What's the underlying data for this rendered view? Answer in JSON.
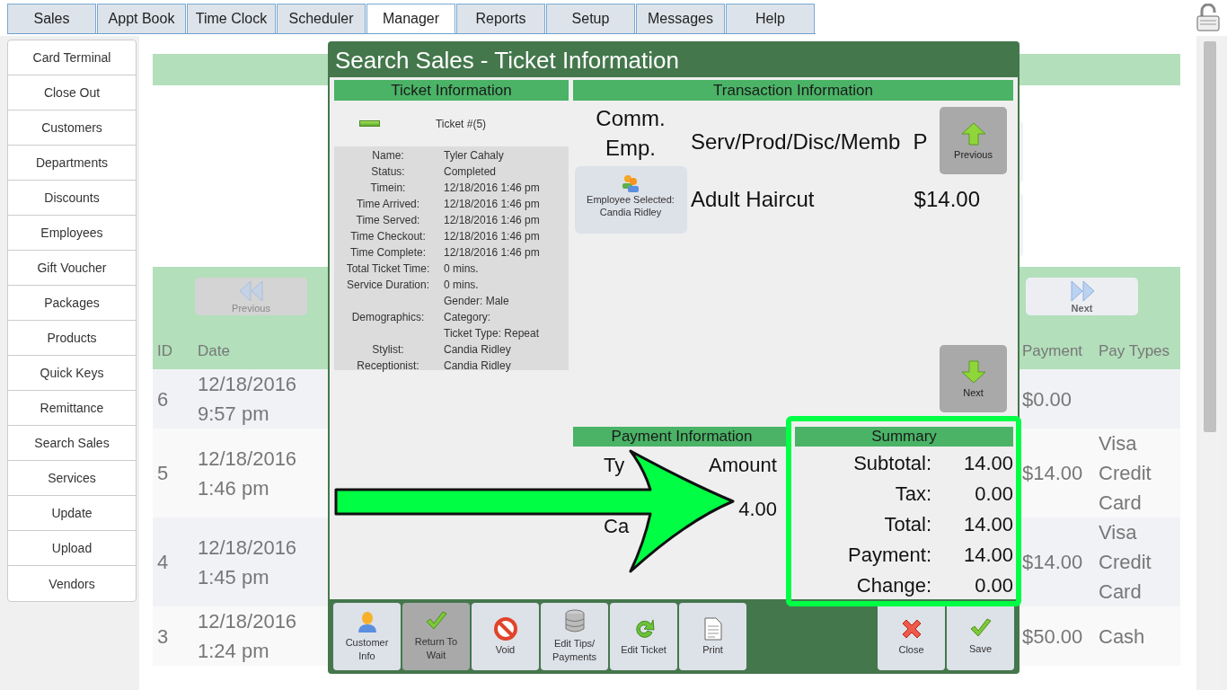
{
  "tabs": [
    {
      "label": "Sales",
      "selected": false
    },
    {
      "label": "Appt Book",
      "selected": false
    },
    {
      "label": "Time Clock",
      "selected": false
    },
    {
      "label": "Scheduler",
      "selected": false
    },
    {
      "label": "Manager",
      "selected": true
    },
    {
      "label": "Reports",
      "selected": false
    },
    {
      "label": "Setup",
      "selected": false
    },
    {
      "label": "Messages",
      "selected": false
    },
    {
      "label": "Help",
      "selected": false
    }
  ],
  "sidebar": {
    "items": [
      "Card Terminal",
      "Close Out",
      "Customers",
      "Departments",
      "Discounts",
      "Employees",
      "Gift Voucher",
      "Packages",
      "Products",
      "Quick Keys",
      "Remittance",
      "Search Sales",
      "Services",
      "Update",
      "Upload",
      "Vendors"
    ]
  },
  "page": {
    "nav_buttons": [
      {
        "label": "Previous",
        "kind": "previous",
        "disabled": true
      },
      {
        "label": "Next",
        "kind": "next",
        "disabled": false
      }
    ],
    "table": {
      "columns": [
        "ID",
        "Date",
        "Payment",
        "Pay Types"
      ],
      "rows": [
        {
          "id": "6",
          "date": "12/18/2016 9:57 pm",
          "payment": "$0.00"
        },
        {
          "id": "5",
          "date": "12/18/2016 1:46 pm",
          "payment": "$14.00",
          "pay_types": "Visa Credit Card"
        },
        {
          "id": "4",
          "date": "12/18/2016 1:45 pm",
          "payment": "$14.00",
          "pay_types": "Visa Credit Card"
        },
        {
          "id": "3",
          "date": "12/18/2016 1:24 pm",
          "payment": "$50.00",
          "pay_types": "Cash"
        }
      ]
    }
  },
  "modal": {
    "title": "Search Sales - Ticket Information",
    "ticket_info": {
      "heading": "Ticket Information",
      "ticket_number": "Ticket #(5)",
      "fields": [
        {
          "label": "Name:",
          "values": [
            "Tyler Cahaly"
          ]
        },
        {
          "label": "Status:",
          "values": [
            "Completed"
          ]
        },
        {
          "label": "Timein:",
          "values": [
            "12/18/2016 1:46 pm"
          ]
        },
        {
          "label": "Time Arrived:",
          "values": [
            "12/18/2016 1:46 pm"
          ]
        },
        {
          "label": "Time Served:",
          "values": [
            "12/18/2016 1:46 pm"
          ]
        },
        {
          "label": "Time Checkout:",
          "values": [
            "12/18/2016 1:46 pm"
          ]
        },
        {
          "label": "Time Complete:",
          "values": [
            "12/18/2016 1:46 pm"
          ]
        },
        {
          "label": "Total Ticket Time:",
          "values": [
            "0 mins."
          ]
        },
        {
          "label": "Service Duration:",
          "values": [
            "0 mins."
          ]
        },
        {
          "label": "Demographics:",
          "values": [
            "Gender: Male",
            "Category:",
            "Ticket Type: Repeat"
          ]
        },
        {
          "label": "Stylist:",
          "values": [
            "Candia Ridley"
          ]
        },
        {
          "label": "Receptionist:",
          "values": [
            "Candia Ridley"
          ]
        }
      ]
    },
    "transaction": {
      "heading": "Transaction Information",
      "comm_emp": "Comm. Emp.",
      "employee_button": "Employee Selected: Candia Ridley",
      "column_headers": [
        "Serv/Prod/Disc/Memb",
        "P"
      ],
      "items": [
        {
          "name": "Adult Haircut",
          "price": "$14.00"
        }
      ],
      "previous": "Previous",
      "next": "Next"
    },
    "payment": {
      "heading": "Payment Information",
      "column_headers": [
        "Ty",
        "Amount"
      ],
      "rows": [
        {
          "type": "Ca",
          "amount": "4.00"
        }
      ]
    },
    "summary": {
      "heading": "Summary",
      "rows": [
        {
          "label": "Subtotal:",
          "value": "14.00"
        },
        {
          "label": "Tax:",
          "value": "0.00"
        },
        {
          "label": "Total:",
          "value": "14.00"
        },
        {
          "label": "Payment:",
          "value": "14.00"
        },
        {
          "label": "Change:",
          "value": "0.00"
        }
      ]
    },
    "actions": [
      {
        "label": "Customer Info",
        "kind": "customer",
        "active": false
      },
      {
        "label": "Return To Wait",
        "kind": "return",
        "active": true
      },
      {
        "label": "Void",
        "kind": "void",
        "active": false
      },
      {
        "label": "Edit Tips/ Payments",
        "kind": "tips",
        "active": false
      },
      {
        "label": "Edit Ticket",
        "kind": "edit",
        "active": false
      },
      {
        "label": "Print",
        "kind": "print",
        "active": false
      }
    ],
    "dialog_buttons": [
      {
        "label": "Close",
        "kind": "close"
      },
      {
        "label": "Save",
        "kind": "save"
      }
    ]
  }
}
